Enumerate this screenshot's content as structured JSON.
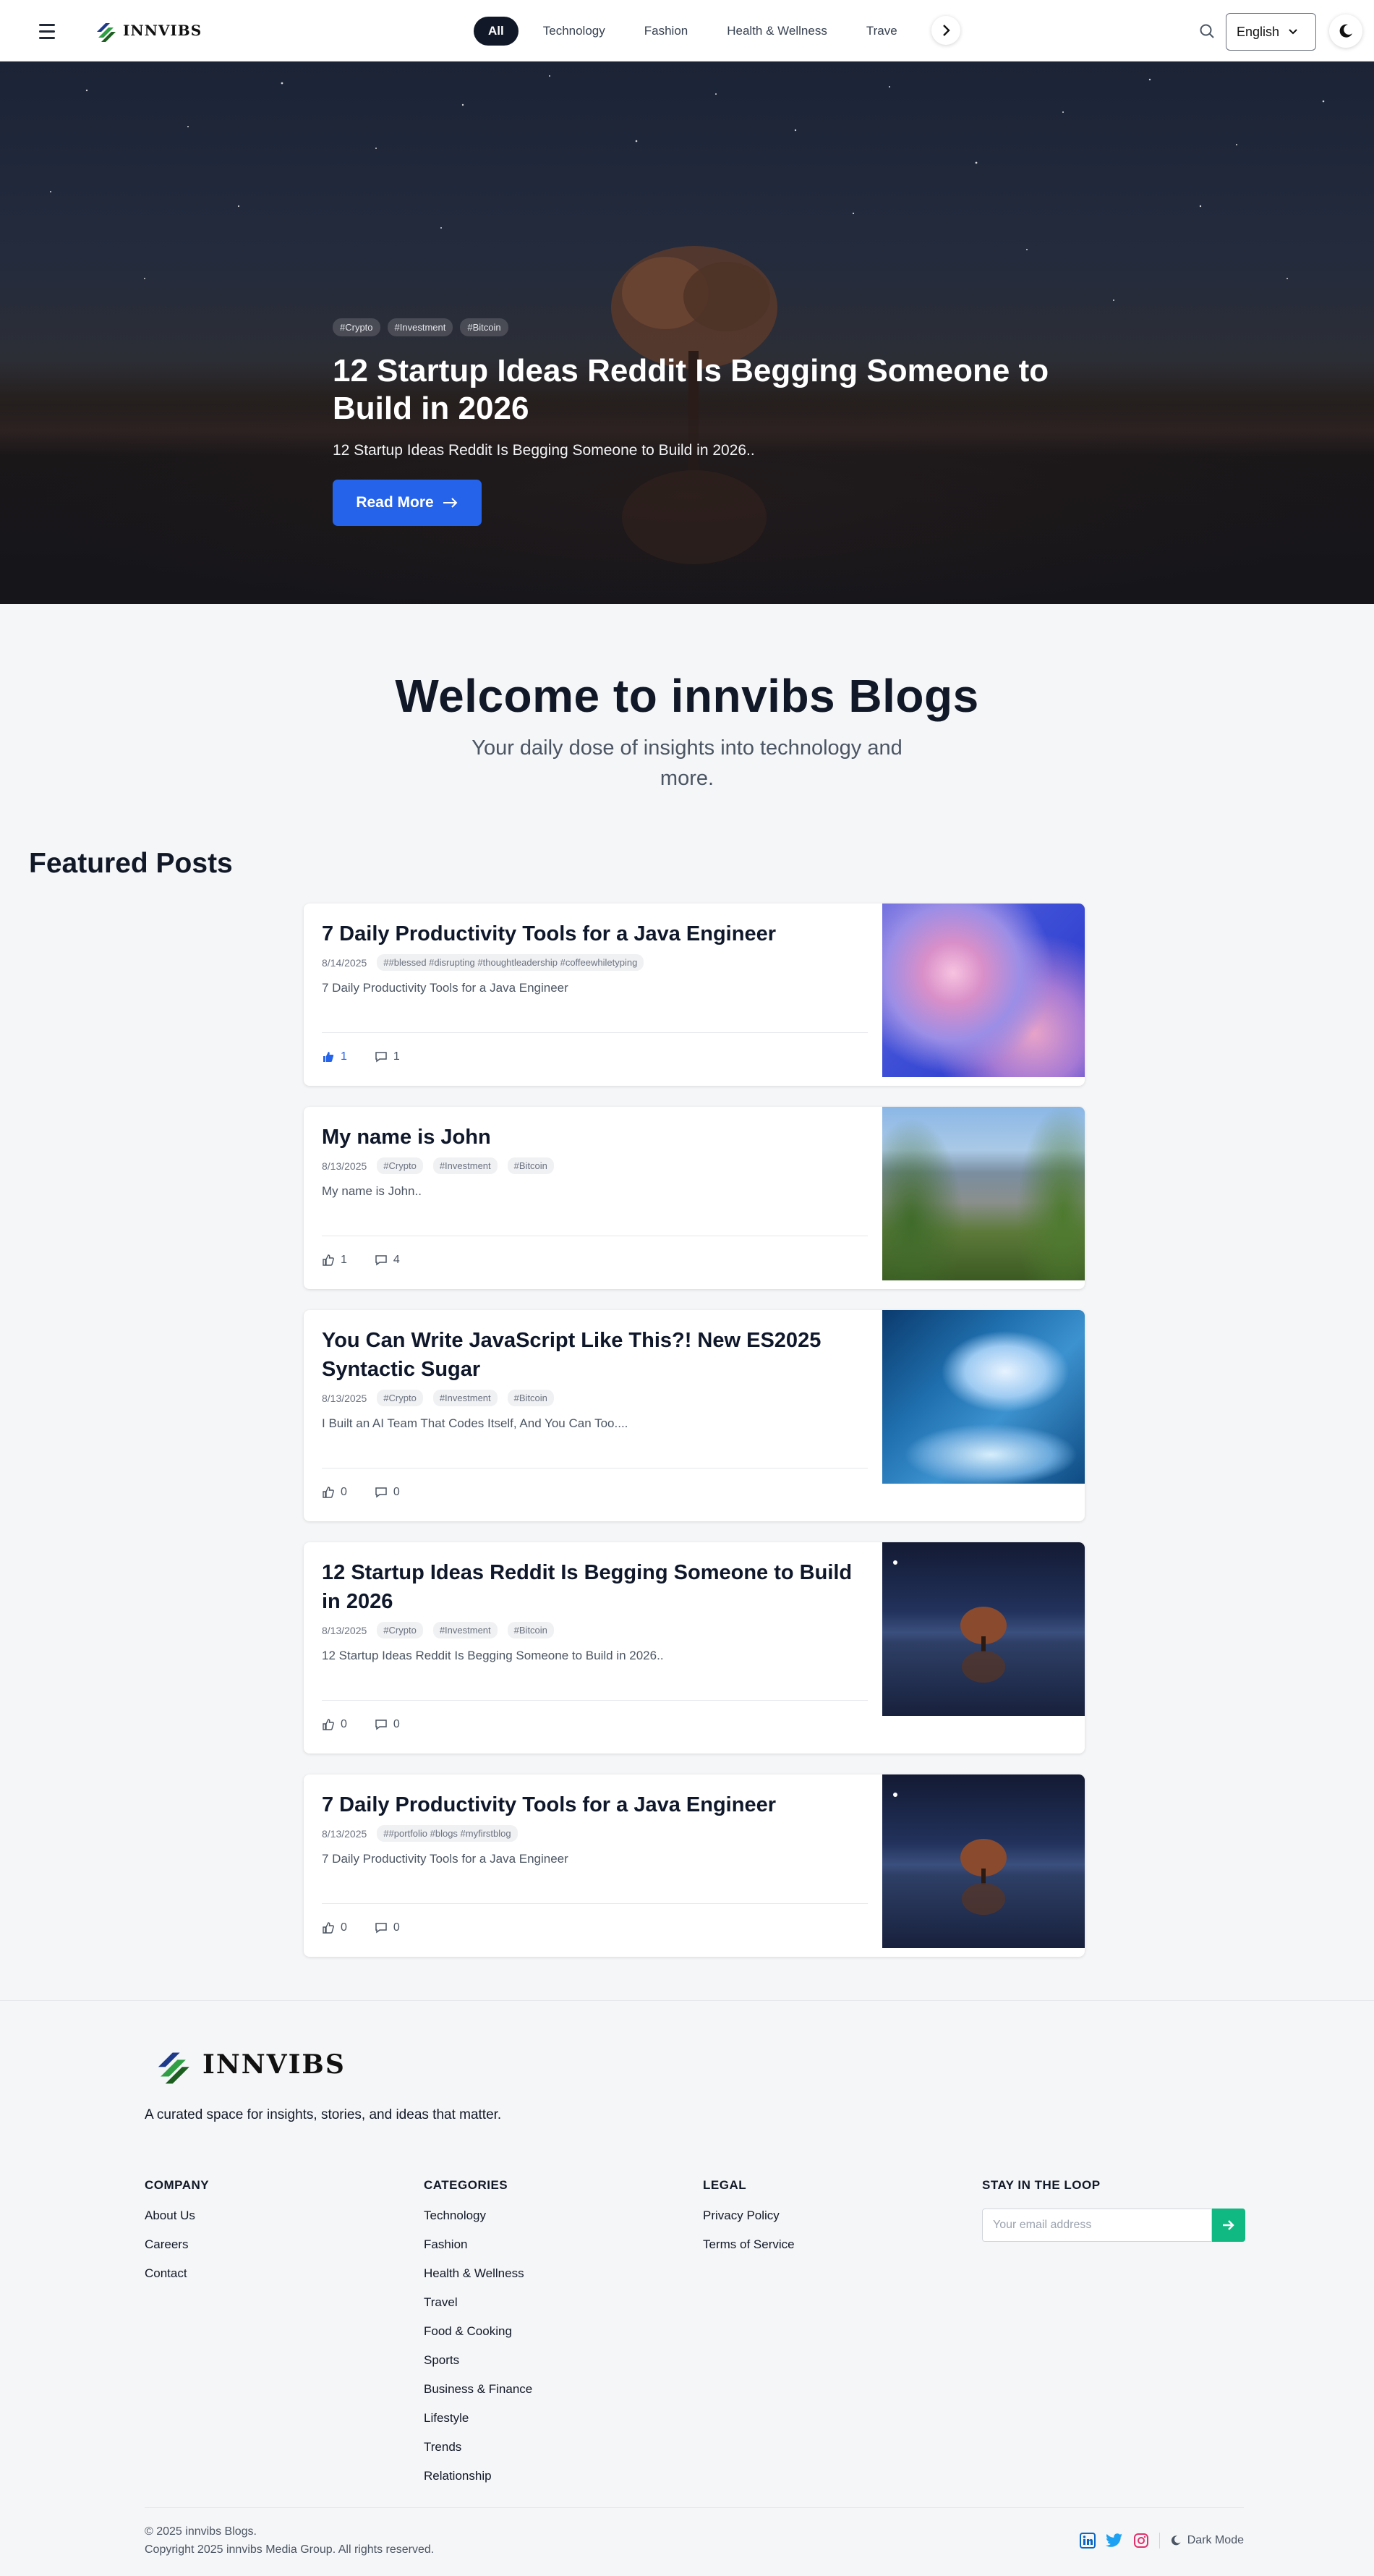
{
  "nav": {
    "logo_text": "INNVIBS",
    "categories": [
      "All",
      "Technology",
      "Fashion",
      "Health & Wellness",
      "Trave"
    ],
    "language": "English"
  },
  "hero": {
    "tags": [
      "#Crypto",
      "#Investment",
      "#Bitcoin"
    ],
    "title": "12 Startup Ideas Reddit Is Begging Someone to Build in 2026",
    "subtitle": "12 Startup Ideas Reddit Is Begging Someone to Build in 2026..",
    "cta": "Read More",
    "slides_count": 5,
    "active_slide": 4
  },
  "welcome": {
    "title": "Welcome to innvibs Blogs",
    "subtitle": "Your daily dose of insights into technology and more."
  },
  "featured": {
    "heading": "Featured Posts",
    "posts": [
      {
        "title": "7 Daily Productivity Tools for a Java Engineer",
        "date": "8/14/2025",
        "tags": [
          "##blessed #disrupting #thoughtleadership #coffeewhiletyping"
        ],
        "excerpt": "7 Daily Productivity Tools for a Java Engineer",
        "likes": "1",
        "comments": "1",
        "liked": true,
        "image": "cloud"
      },
      {
        "title": "My name is John",
        "date": "8/13/2025",
        "tags": [
          "#Crypto",
          "#Investment",
          "#Bitcoin"
        ],
        "excerpt": "My name is John..",
        "likes": "1",
        "comments": "4",
        "liked": false,
        "image": "canyon"
      },
      {
        "title": "You Can Write JavaScript Like This?! New ES2025 Syntactic Sugar",
        "date": "8/13/2025",
        "tags": [
          "#Crypto",
          "#Investment",
          "#Bitcoin"
        ],
        "excerpt": "I Built an AI Team That Codes Itself, And You Can Too....",
        "likes": "0",
        "comments": "0",
        "liked": false,
        "image": "ice-cave"
      },
      {
        "title": "12 Startup Ideas Reddit Is Begging Someone to Build in 2026",
        "date": "8/13/2025",
        "tags": [
          "#Crypto",
          "#Investment",
          "#Bitcoin"
        ],
        "excerpt": "12 Startup Ideas Reddit Is Begging Someone to Build in 2026..",
        "likes": "0",
        "comments": "0",
        "liked": false,
        "image": "tree"
      },
      {
        "title": "7 Daily Productivity Tools for a Java Engineer",
        "date": "8/13/2025",
        "tags": [
          "##portfolio #blogs #myfirstblog"
        ],
        "excerpt": "7 Daily Productivity Tools for a Java Engineer",
        "likes": "0",
        "comments": "0",
        "liked": false,
        "image": "tree"
      }
    ]
  },
  "footer": {
    "logo_text": "INNVIBS",
    "tagline": "A curated space for insights, stories, and ideas that matter.",
    "company": {
      "heading": "COMPANY",
      "links": [
        "About Us",
        "Careers",
        "Contact"
      ]
    },
    "categories": {
      "heading": "CATEGORIES",
      "links": [
        "Technology",
        "Fashion",
        "Health & Wellness",
        "Travel",
        "Food & Cooking",
        "Sports",
        "Business & Finance",
        "Lifestyle",
        "Trends",
        "Relationship"
      ]
    },
    "legal": {
      "heading": "LEGAL",
      "links": [
        "Privacy Policy",
        "Terms of Service"
      ]
    },
    "newsletter": {
      "heading": "STAY IN THE LOOP",
      "placeholder": "Your email address"
    },
    "copyright_1": "© 2025 innvibs Blogs.",
    "copyright_2": "Copyright 2025 innvibs Media Group. All rights reserved.",
    "dark_mode_label": "Dark Mode",
    "colors": {
      "linkedin": "#0a66c2",
      "twitter": "#1da1f2",
      "instagram": "#e1306c",
      "subscribe": "#10b981"
    }
  }
}
